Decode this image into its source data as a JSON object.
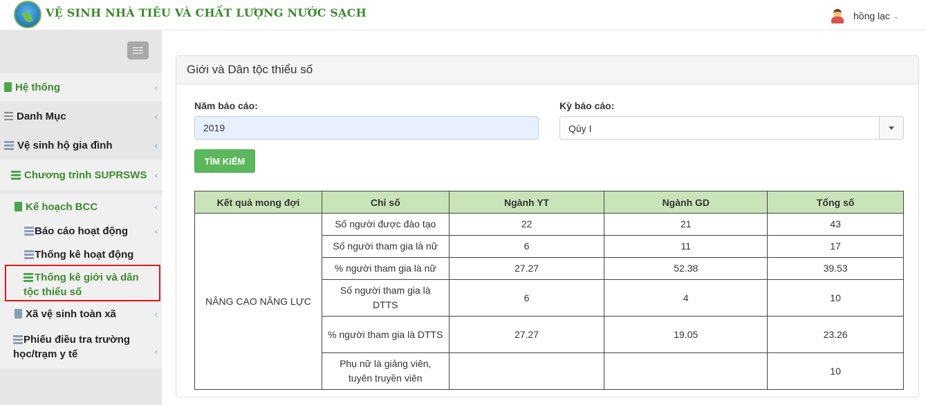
{
  "app": {
    "title": "VỆ SINH NHÀ TIÊU VÀ CHẤT LƯỢNG NƯỚC SẠCH",
    "user_name": "hồng lạc"
  },
  "sidebar": {
    "items": [
      {
        "label": "Hệ thống",
        "icon": "document-icon"
      },
      {
        "label": "Danh Mục",
        "icon": "list-icon"
      },
      {
        "label": "Vệ sinh hộ gia đình",
        "icon": "server-icon"
      },
      {
        "label": "Chương trình SUPRSWS",
        "icon": "server-icon"
      },
      {
        "label": "Kế hoạch BCC",
        "icon": "document-icon"
      },
      {
        "label": "Báo cáo hoạt động",
        "icon": "server-icon"
      },
      {
        "label": "Thống kê hoạt động",
        "icon": "server-icon"
      },
      {
        "label": "Thống kê giới và dân tộc thiểu số",
        "icon": "server-icon"
      },
      {
        "label": "Xã vệ sinh toàn xã",
        "icon": "document-icon"
      },
      {
        "label": "Phiếu điều tra trường học/trạm y tế",
        "icon": "server-icon"
      }
    ]
  },
  "panel": {
    "title": "Giới và Dân tộc thiểu số",
    "year_label": "Năm báo cáo:",
    "year_value": "2019",
    "period_label": "Kỳ báo cáo:",
    "period_value": "Qúy I",
    "search_label": "TÌM KIẾM"
  },
  "table": {
    "headers": [
      "Kết quả mong đợi",
      "Chỉ số",
      "Ngành YT",
      "Ngành GD",
      "Tổng số"
    ],
    "group_label": "NÂNG CAO NĂNG LỰC",
    "rows": [
      {
        "indicator": "Số người được đào tạo",
        "yt": "22",
        "gd": "21",
        "total": "43"
      },
      {
        "indicator": "Số người tham gia là nữ",
        "yt": "6",
        "gd": "11",
        "total": "17"
      },
      {
        "indicator": "% người tham gia là nữ",
        "yt": "27.27",
        "gd": "52.38",
        "total": "39.53"
      },
      {
        "indicator": "Số người tham gia là DTTS",
        "yt": "6",
        "gd": "4",
        "total": "10"
      },
      {
        "indicator": "% người tham gia là DTTS",
        "yt": "27.27",
        "gd": "19.05",
        "total": "23.26"
      },
      {
        "indicator": "Phụ nữ là giảng viên, tuyên truyền viên",
        "yt": "",
        "gd": "",
        "total": "10"
      }
    ]
  },
  "colors": {
    "brand_green": "#3c8a2e",
    "button_green": "#5cb85c",
    "table_header": "#c9e4b8",
    "highlight_red": "#e0161b",
    "sidebar_bg": "#e6e6e6"
  }
}
